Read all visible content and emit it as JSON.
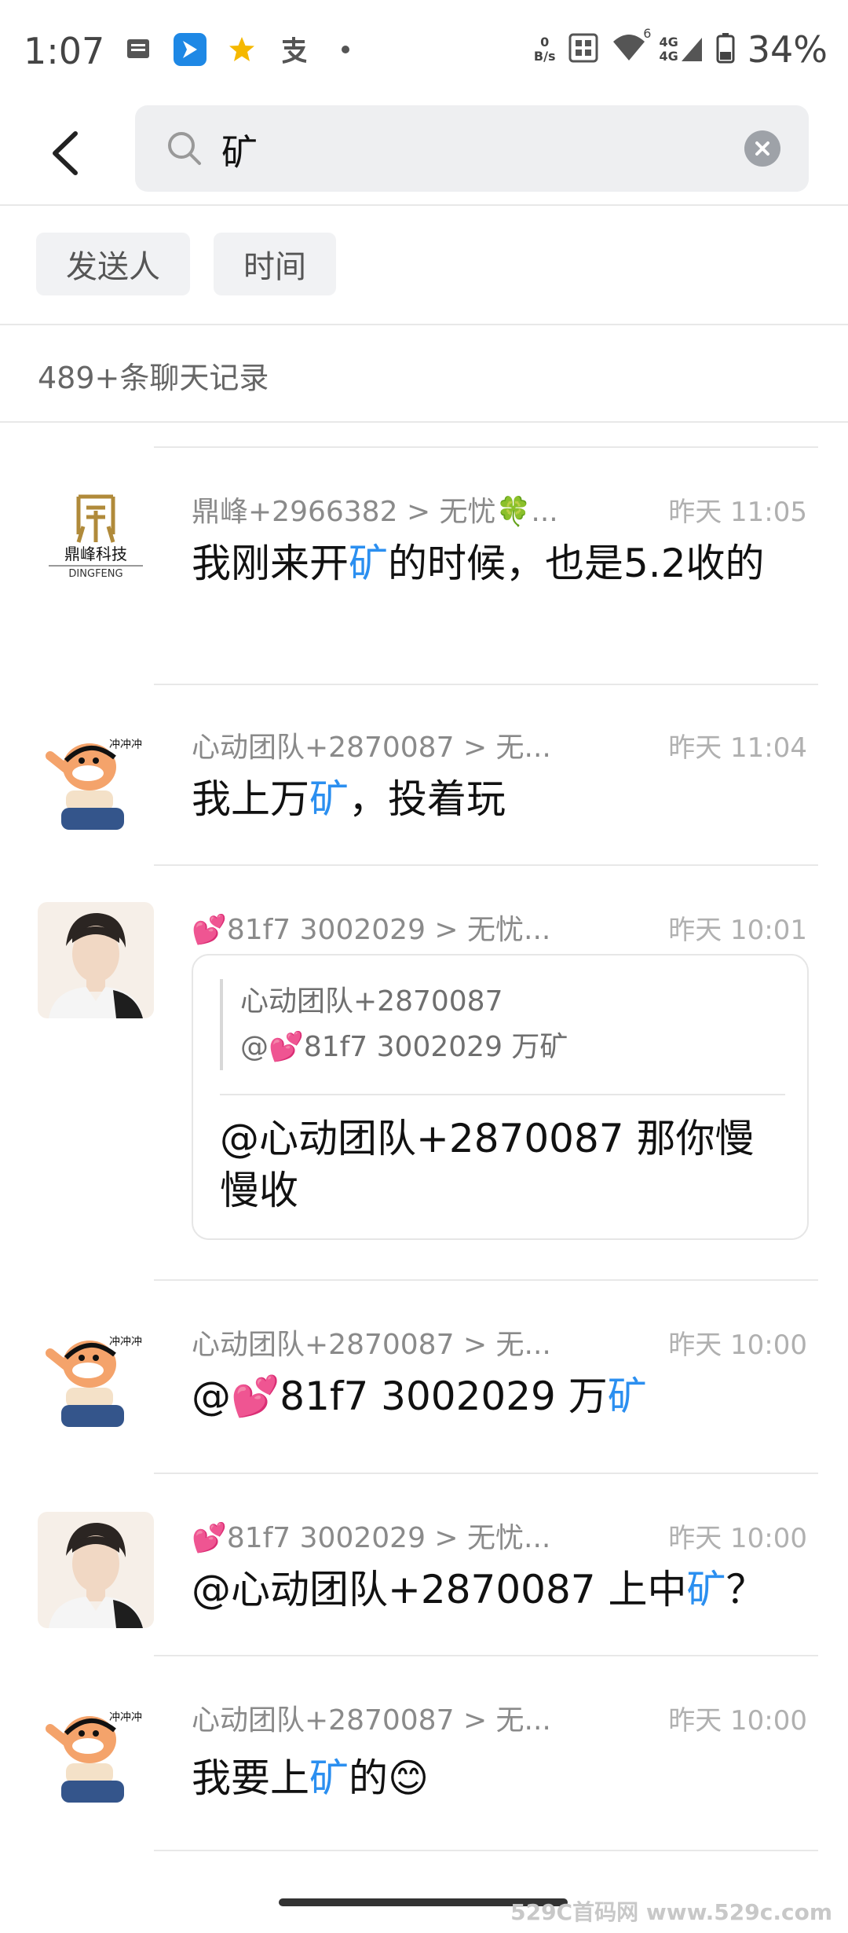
{
  "status_bar": {
    "time": "1:07",
    "net_speed_value": "0",
    "net_speed_unit": "B/s",
    "battery": "34%",
    "signal_1": "4G",
    "signal_2": "4G",
    "signal_super": "6"
  },
  "search": {
    "query": "矿"
  },
  "filters": {
    "sender": "发送人",
    "time": "时间"
  },
  "record_count": "489+条聊天记录",
  "colors": {
    "highlight": "#2b8ff0"
  },
  "messages": [
    {
      "avatar": "dingfeng-logo",
      "avatar_text": "鼎峰科技",
      "avatar_sub": "DINGFENG",
      "sender": "鼎峰+2966382 > 无忧🍀...",
      "time": "昨天 11:05",
      "pre": "我刚来开",
      "hl": "矿",
      "post": "的时候，也是5.2收的"
    },
    {
      "avatar": "cartoon-avatar",
      "sender": "心动团队+2870087 > 无...",
      "time": "昨天 11:04",
      "pre": "我上万",
      "hl": "矿",
      "post": "，投着玩"
    },
    {
      "avatar": "portrait-avatar",
      "sender": "💕81f7   3002029 > 无忧...",
      "time": "昨天 10:01",
      "quote_author": "心动团队+2870087",
      "quote_text": "@💕81f7   3002029 万矿",
      "reply": "@心动团队+2870087 那你慢慢收"
    },
    {
      "avatar": "cartoon-avatar",
      "sender": "心动团队+2870087 > 无...",
      "time": "昨天 10:00",
      "pre": "@💕81f7   3002029 万",
      "hl": "矿",
      "post": ""
    },
    {
      "avatar": "portrait-avatar",
      "sender": "💕81f7   3002029 > 无忧...",
      "time": "昨天 10:00",
      "pre": "@心动团队+2870087 上中",
      "hl": "矿",
      "post": "？"
    },
    {
      "avatar": "cartoon-avatar",
      "sender": "心动团队+2870087 > 无...",
      "time": "昨天 10:00",
      "pre": "我要上",
      "hl": "矿",
      "post": "的😊"
    }
  ],
  "watermark": "529C首码网 www.529c.com"
}
